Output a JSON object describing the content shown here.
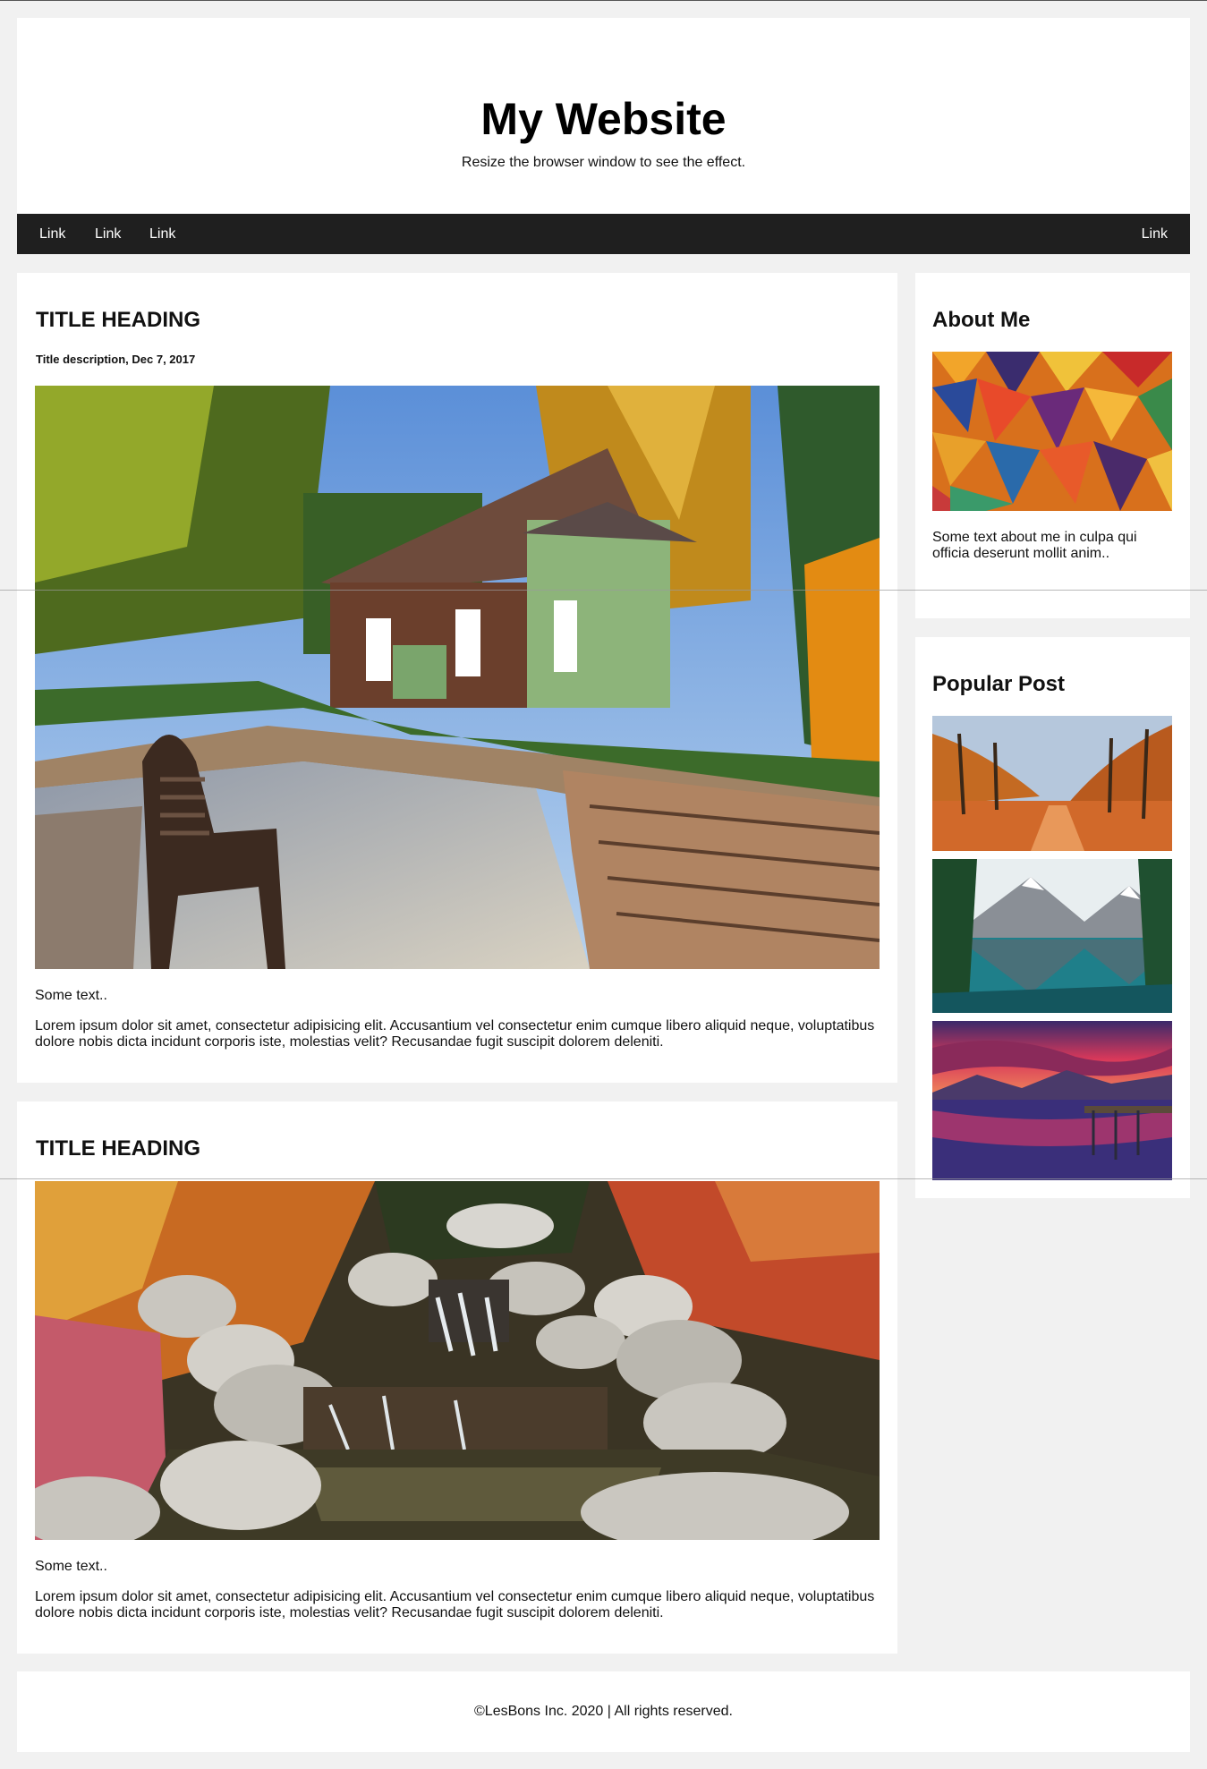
{
  "header": {
    "title": "My Website",
    "subtitle": "Resize the browser window to see the effect."
  },
  "nav": {
    "links": [
      "Link",
      "Link",
      "Link"
    ],
    "right_link": "Link"
  },
  "posts": [
    {
      "title": "TITLE HEADING",
      "description": "Title description, Dec 7, 2017",
      "image": "cabin-garden-photo",
      "lead": "Some text..",
      "body": "Lorem ipsum dolor sit amet, consectetur adipisicing elit. Accusantium vel consectetur enim cumque libero aliquid neque, voluptatibus dolore nobis dicta incidunt corporis iste, molestias velit? Recusandae fugit suscipit dolorem deleniti."
    },
    {
      "title": "TITLE HEADING",
      "image": "waterfall-rocks-photo",
      "lead": "Some text..",
      "body": "Lorem ipsum dolor sit amet, consectetur adipisicing elit. Accusantium vel consectetur enim cumque libero aliquid neque, voluptatibus dolore nobis dicta incidunt corporis iste, molestias velit? Recusandae fugit suscipit dolorem deleniti."
    }
  ],
  "sidebar": {
    "about": {
      "title": "About Me",
      "image": "abstract-mosaic-photo",
      "text": "Some text about me in culpa qui officia deserunt mollit anim.."
    },
    "popular": {
      "title": "Popular Post",
      "images": [
        "autumn-trees-photo",
        "mountain-lake-photo",
        "sunset-lake-photo"
      ]
    }
  },
  "footer": {
    "text": "©LesBons Inc. 2020 | All rights reserved."
  },
  "colors": {
    "page_background": "#f1f1f1",
    "card_background": "#ffffff",
    "navbar_background": "#1f1f1f",
    "navbar_text": "#ffffff"
  }
}
